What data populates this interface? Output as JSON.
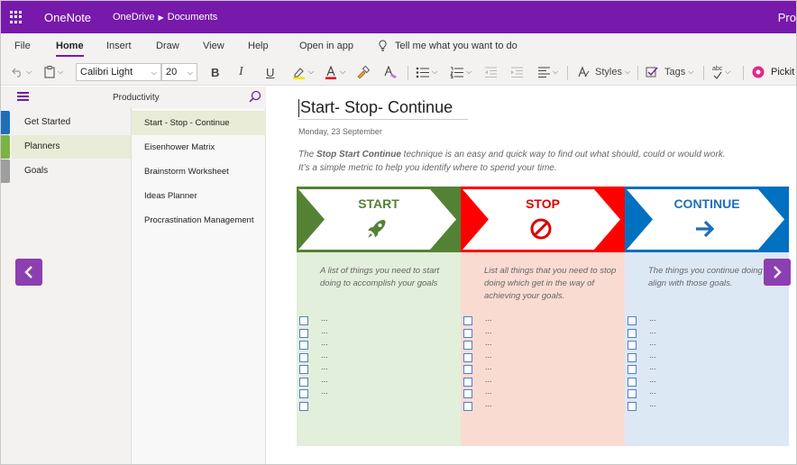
{
  "app": {
    "name": "OneNote",
    "breadcrumb": [
      "OneDrive",
      "Documents"
    ],
    "title_right": "Pro"
  },
  "ribbon": {
    "tabs": [
      "File",
      "Home",
      "Insert",
      "Draw",
      "View",
      "Help",
      "Open in app"
    ],
    "active_tab": "Home",
    "tell_me": "Tell me what you want to do"
  },
  "toolbar": {
    "font_name": "Calibri Light",
    "font_size": "20",
    "bold": "B",
    "italic": "I",
    "underline": "U",
    "styles_label": "Styles",
    "tags_label": "Tags",
    "pickit_label": "Pickit",
    "spell_label": "abc"
  },
  "notebook": {
    "name": "Productivity",
    "sections": [
      {
        "label": "Get Started",
        "color": "#1f6fb8"
      },
      {
        "label": "Planners",
        "color": "#7cb342",
        "active": true
      },
      {
        "label": "Goals",
        "color": "#9e9e9e"
      }
    ],
    "pages": [
      {
        "label": "Start - Stop - Continue",
        "active": true
      },
      {
        "label": "Eisenhower Matrix"
      },
      {
        "label": "Brainstorm Worksheet"
      },
      {
        "label": "Ideas Planner"
      },
      {
        "label": "Procrastination Management"
      }
    ]
  },
  "page": {
    "title": "Start- Stop- Continue",
    "date": "Monday, 23 September",
    "intro_prefix": "The ",
    "intro_bold": "Stop Start Continue",
    "intro_line1_rest": " technique is an easy and quick way to find out what should, could or would work.",
    "intro_line2": "It’s a simple metric to help you identify where to spend your time."
  },
  "board": [
    {
      "label": "START",
      "icon": "rocket-icon",
      "banner_color": "#548235",
      "label_color": "#548235",
      "body_color": "#e2efda",
      "desc": "A list of things you need to start doing to accomplish your goals",
      "items": [
        "...",
        "...",
        "...",
        "...",
        "...",
        "...",
        "...",
        ""
      ]
    },
    {
      "label": "STOP",
      "icon": "stop-sign-icon",
      "banner_color": "#ff0000",
      "label_color": "#e00000",
      "body_color": "#fadbd2",
      "desc": "List all things that you need to stop doing which get in the way of achieving your goals.",
      "items": [
        "...",
        "...",
        "...",
        "...",
        "...",
        "...",
        "...",
        "..."
      ]
    },
    {
      "label": "CONTINUE",
      "icon": "arrow-right-icon",
      "banner_color": "#0070c0",
      "label_color": "#1f6fb8",
      "body_color": "#dde8f5",
      "desc": "The things you continue doing that align with those goals.",
      "items": [
        "...",
        "...",
        "...",
        "...",
        "...",
        "...",
        "...",
        "..."
      ]
    }
  ],
  "colors": {
    "accent": "#7719aa",
    "nav_button": "#8c3fb0",
    "checkbox": "#4f7ec9"
  }
}
